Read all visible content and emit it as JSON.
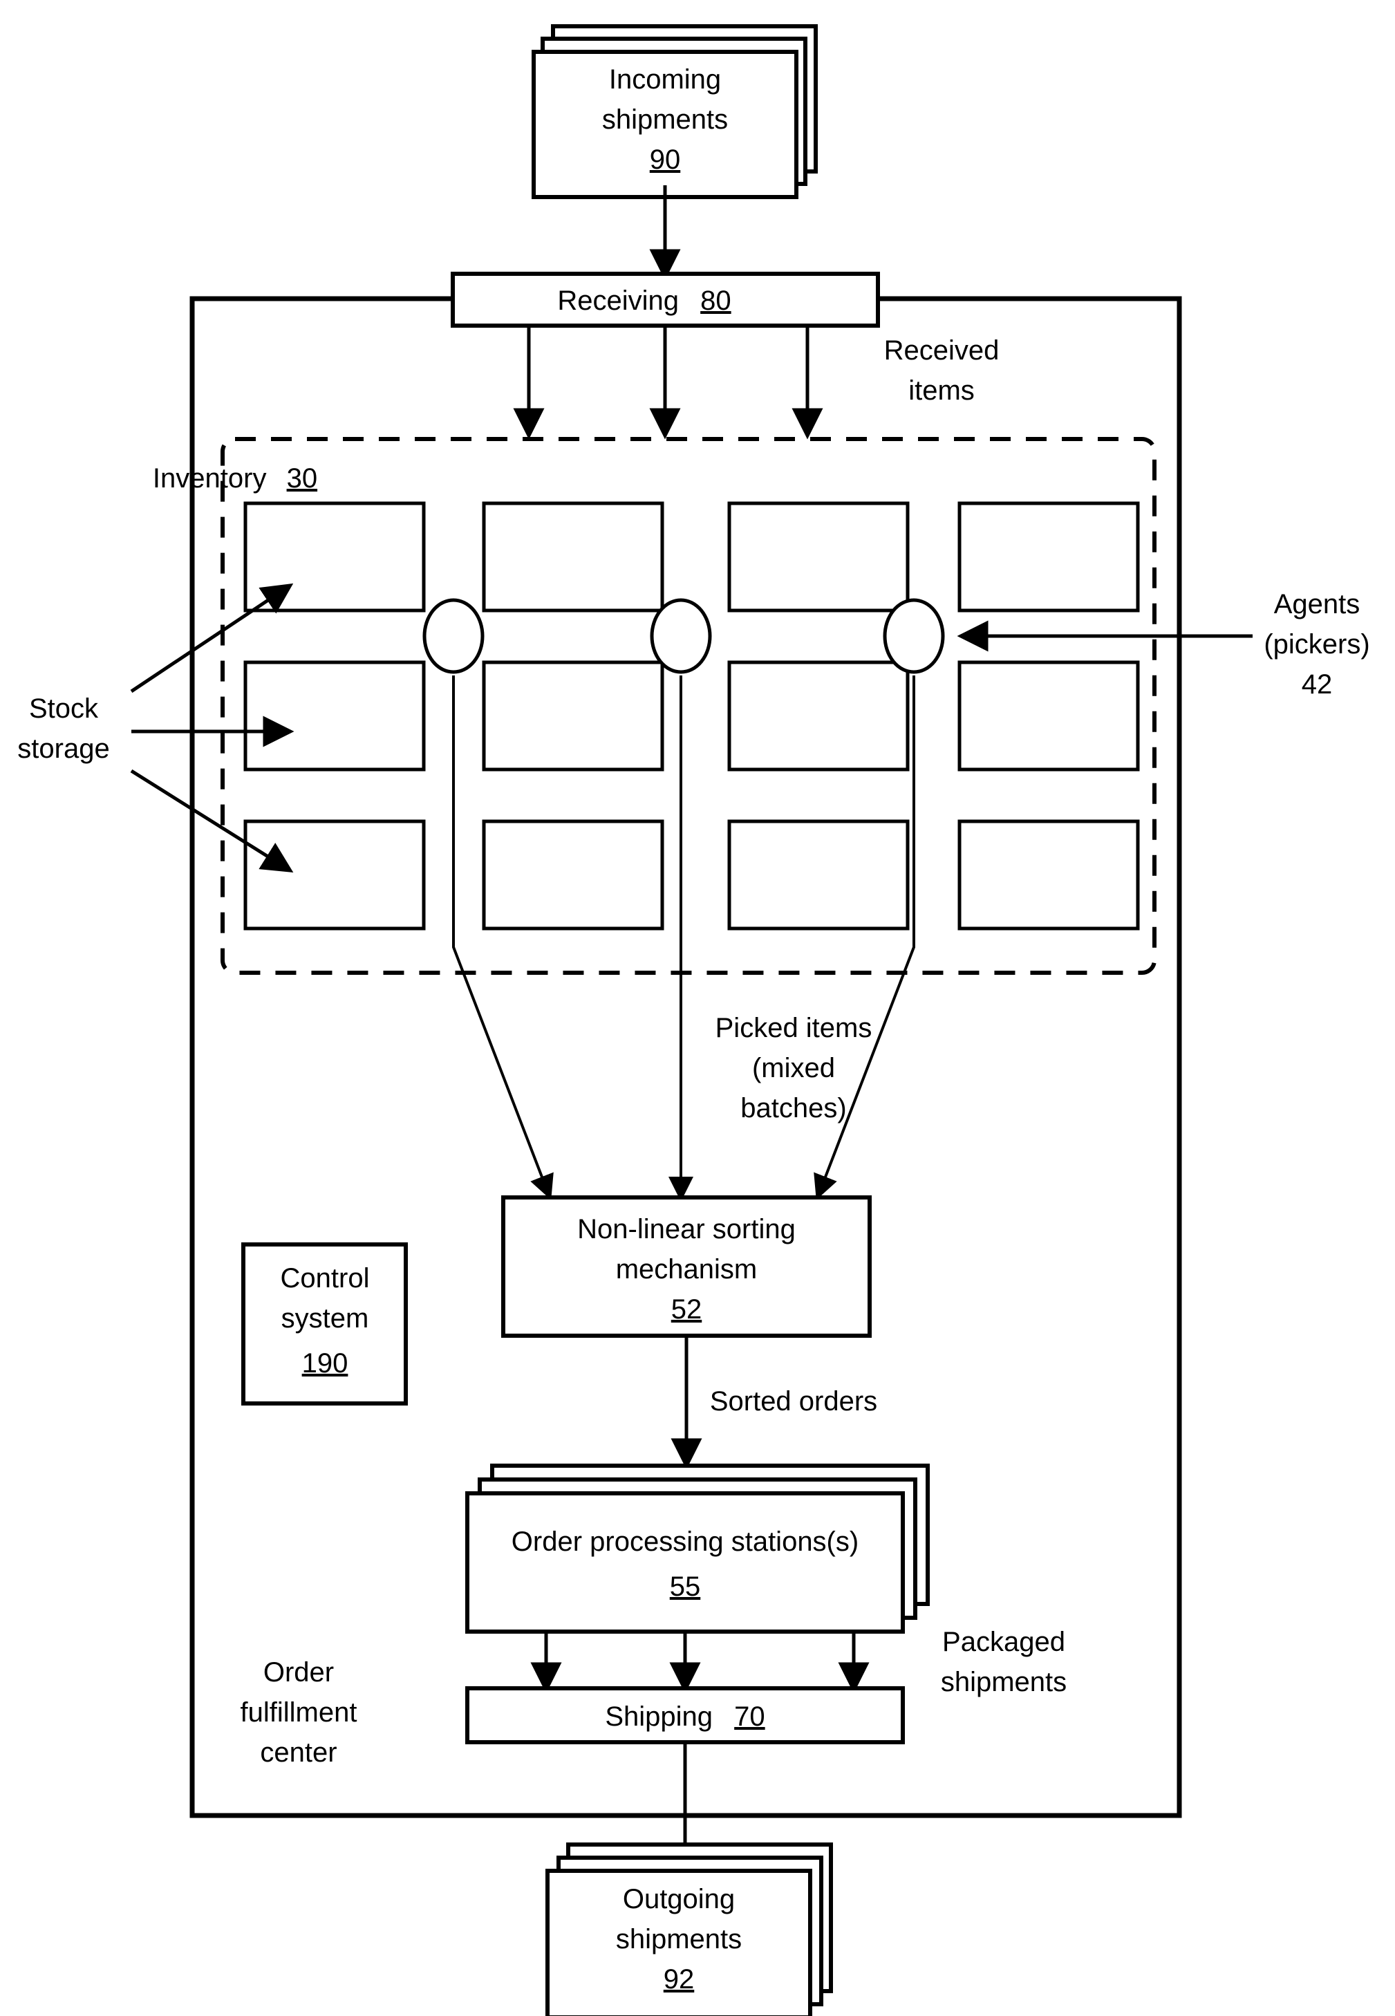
{
  "figure": {
    "title": "Order fulfillment center material flow diagram",
    "ink_color": "#000000",
    "background_color": "#ffffff"
  },
  "nodes": {
    "incoming_shipments": {
      "line1": "Incoming",
      "line2": "shipments",
      "ref": "90"
    },
    "receiving": {
      "label": "Receiving",
      "ref": "80"
    },
    "inventory": {
      "label": "Inventory",
      "ref": "30"
    },
    "sorting": {
      "line1": "Non-linear sorting",
      "line2": "mechanism",
      "ref": "52"
    },
    "control_system": {
      "line1": "Control",
      "line2": "system",
      "ref": "190"
    },
    "order_processing": {
      "label": "Order processing stations(s)",
      "ref": "55"
    },
    "shipping": {
      "label": "Shipping",
      "ref": "70"
    },
    "outgoing_shipments": {
      "line1": "Outgoing",
      "line2": "shipments",
      "ref": "92"
    }
  },
  "annotations": {
    "received_items": {
      "line1": "Received",
      "line2": "items"
    },
    "agents": {
      "line1": "Agents",
      "line2": "(pickers)",
      "ref": "42"
    },
    "stock_storage": {
      "line1": "Stock",
      "line2": "storage"
    },
    "picked_items": {
      "line1": "Picked items",
      "line2": "(mixed",
      "line3": "batches)"
    },
    "sorted_orders": {
      "label": "Sorted orders"
    },
    "packaged_shipments": {
      "line1": "Packaged",
      "line2": "shipments"
    },
    "order_fulfillment_center": {
      "line1": "Order",
      "line2": "fulfillment",
      "line3": "center"
    }
  },
  "inventory_grid": {
    "rows": 3,
    "columns": 4,
    "agent_count": 3
  }
}
